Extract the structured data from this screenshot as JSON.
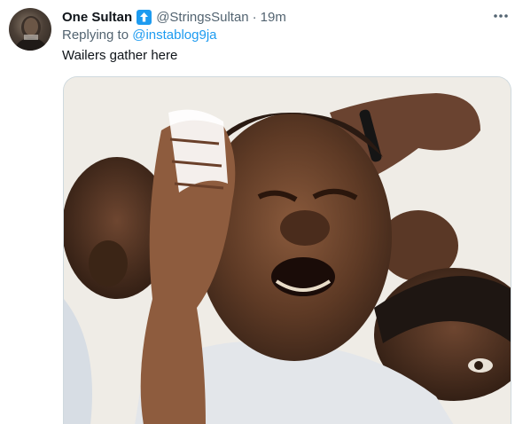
{
  "tweet": {
    "display_name": "One Sultan",
    "handle": "@StringsSultan",
    "separator": "·",
    "time": "19m",
    "replying_to_prefix": "Replying to",
    "replying_to_handle": "@instablog9ja",
    "text": "Wailers gather here"
  },
  "icons": {
    "verified_badge": "up-arrow-badge-icon",
    "more": "more-horizontal-icon"
  },
  "colors": {
    "accent": "#1d9bf0",
    "text_primary": "#0f1419",
    "text_secondary": "#536471"
  }
}
